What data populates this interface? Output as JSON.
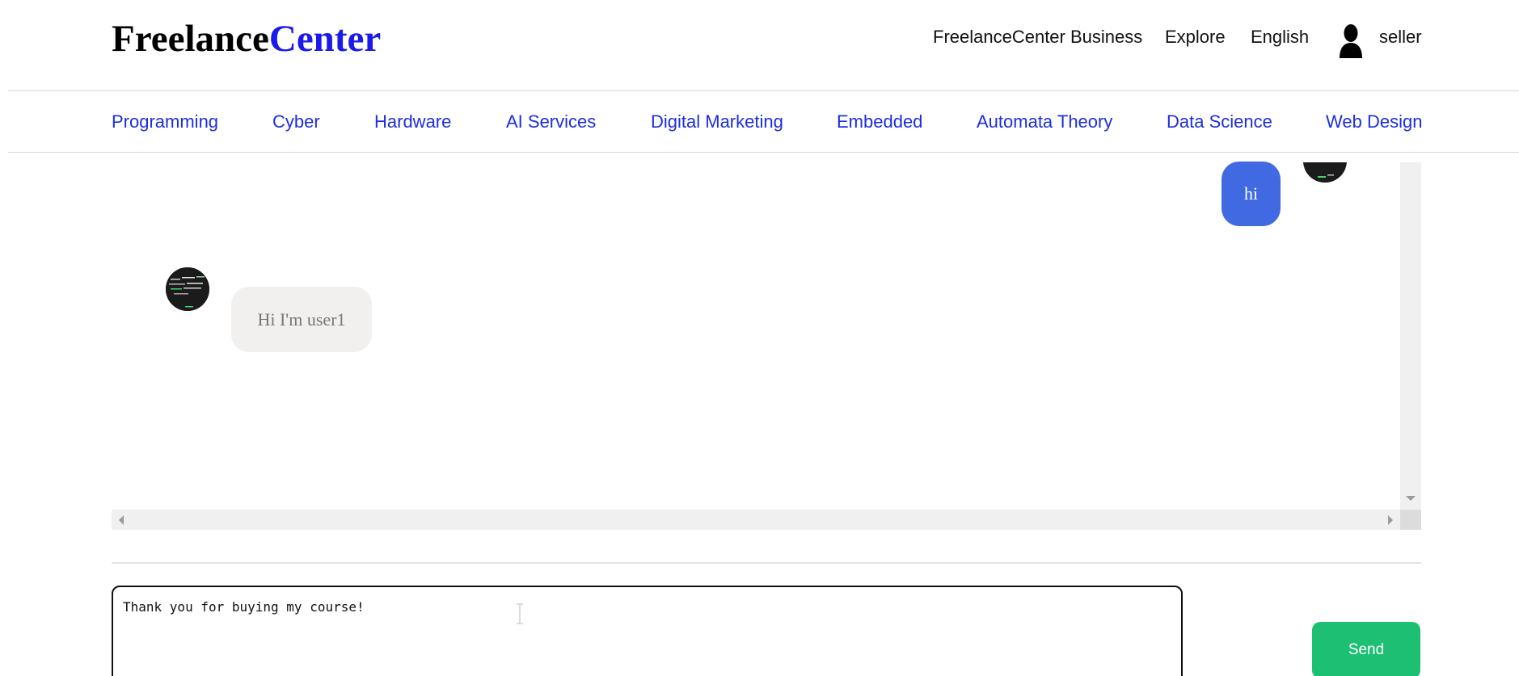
{
  "brand": {
    "part1": "Freelance",
    "part2": "Center",
    "part2_color": "#1a1aeb"
  },
  "topnav": {
    "business": "FreelanceCenter Business",
    "explore": "Explore",
    "language": "English",
    "username": "seller",
    "user_icon": "user-silhouette-icon"
  },
  "categories": [
    "Programming",
    "Cyber",
    "Hardware",
    "AI Services",
    "Digital Marketing",
    "Embedded",
    "Automata Theory",
    "Data Science",
    "Web Design"
  ],
  "chat": {
    "messages": [
      {
        "from": "seller",
        "text": "hi",
        "color": "#4169e1"
      },
      {
        "from": "user1",
        "text": "Hi I'm user1",
        "color": "#f2f0ee"
      }
    ]
  },
  "composer": {
    "value": "Thank you for buying my course!",
    "send_label": "Send",
    "send_color": "#1dbf73"
  }
}
